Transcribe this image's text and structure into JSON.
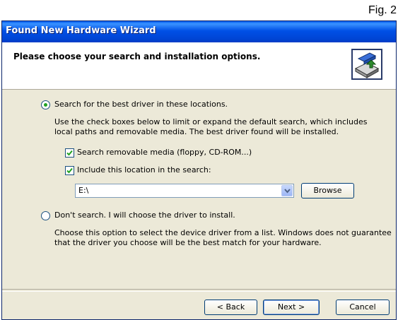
{
  "figure_label": "Fig. 2",
  "window": {
    "title": "Found New Hardware Wizard",
    "header_title": "Please choose your search and installation options.",
    "header_icon": "hardware-install-icon"
  },
  "options": {
    "search_radio_label": "Search for the best driver in these locations.",
    "search_radio_selected": true,
    "search_description": "Use the check boxes below to limit or expand the default search, which includes local paths and removable media. The best driver found will be installed.",
    "removable_media_label": "Search removable media (floppy, CD-ROM...)",
    "removable_media_checked": true,
    "include_location_label": "Include this location in the search:",
    "include_location_checked": true,
    "location_value": "E:\\",
    "browse_label": "Browse",
    "dont_search_label": "Don't search. I will choose the driver to install.",
    "dont_search_selected": false,
    "dont_search_description": "Choose this option to select the device driver from a list.  Windows does not guarantee that the driver you choose will be the best match for your hardware."
  },
  "footer": {
    "back_label": "< Back",
    "next_label": "Next >",
    "cancel_label": "Cancel"
  },
  "colors": {
    "titlebar": "#0054e3",
    "dialog_bg": "#ece9d8",
    "check_green": "#21a121"
  }
}
